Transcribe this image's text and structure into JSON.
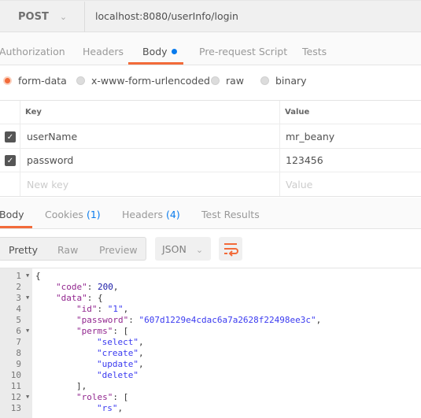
{
  "request": {
    "method": "POST",
    "url": "localhost:8080/userInfo/login"
  },
  "request_tabs": [
    {
      "label": "Authorization"
    },
    {
      "label": "Headers"
    },
    {
      "label": "Body",
      "active": true
    },
    {
      "label": "Pre-request Script"
    },
    {
      "label": "Tests"
    }
  ],
  "body_types": [
    {
      "label": "form-data",
      "selected": true
    },
    {
      "label": "x-www-form-urlencoded"
    },
    {
      "label": "raw"
    },
    {
      "label": "binary"
    }
  ],
  "params": {
    "key_header": "Key",
    "value_header": "Value",
    "rows": [
      {
        "key": "userName",
        "value": "mr_beany",
        "checked": true
      },
      {
        "key": "password",
        "value": "123456",
        "checked": true
      }
    ],
    "new_key_placeholder": "New key",
    "new_value_placeholder": "Value"
  },
  "response_tabs": [
    {
      "label": "Body",
      "active": true
    },
    {
      "label": "Cookies",
      "count": "(1)"
    },
    {
      "label": "Headers",
      "count": "(4)"
    },
    {
      "label": "Test Results"
    }
  ],
  "view_modes": [
    "Pretty",
    "Raw",
    "Preview"
  ],
  "format": "JSON",
  "colors": {
    "accent": "#f26b3a",
    "blue": "#097bed"
  },
  "code_lines": [
    {
      "n": "1",
      "fold": true,
      "indent": 0,
      "parts": [
        [
          "p",
          "{"
        ]
      ]
    },
    {
      "n": "2",
      "indent": 1,
      "parts": [
        [
          "k",
          "\"code\""
        ],
        [
          "p",
          ": "
        ],
        [
          "n",
          "200"
        ],
        [
          "p",
          ","
        ]
      ]
    },
    {
      "n": "3",
      "fold": true,
      "indent": 1,
      "parts": [
        [
          "k",
          "\"data\""
        ],
        [
          "p",
          ": {"
        ]
      ]
    },
    {
      "n": "4",
      "indent": 2,
      "parts": [
        [
          "k",
          "\"id\""
        ],
        [
          "p",
          ": "
        ],
        [
          "s",
          "\"1\""
        ],
        [
          "p",
          ","
        ]
      ]
    },
    {
      "n": "5",
      "indent": 2,
      "parts": [
        [
          "k",
          "\"password\""
        ],
        [
          "p",
          ": "
        ],
        [
          "s",
          "\"607d1229e4cdac6a7a2628f22498ee3c\""
        ],
        [
          "p",
          ","
        ]
      ]
    },
    {
      "n": "6",
      "fold": true,
      "indent": 2,
      "parts": [
        [
          "k",
          "\"perms\""
        ],
        [
          "p",
          ": ["
        ]
      ]
    },
    {
      "n": "7",
      "indent": 3,
      "parts": [
        [
          "s",
          "\"select\""
        ],
        [
          "p",
          ","
        ]
      ]
    },
    {
      "n": "8",
      "indent": 3,
      "parts": [
        [
          "s",
          "\"create\""
        ],
        [
          "p",
          ","
        ]
      ]
    },
    {
      "n": "9",
      "indent": 3,
      "parts": [
        [
          "s",
          "\"update\""
        ],
        [
          "p",
          ","
        ]
      ]
    },
    {
      "n": "10",
      "indent": 3,
      "parts": [
        [
          "s",
          "\"delete\""
        ]
      ]
    },
    {
      "n": "11",
      "indent": 2,
      "parts": [
        [
          "p",
          "],"
        ]
      ]
    },
    {
      "n": "12",
      "fold": true,
      "indent": 2,
      "parts": [
        [
          "k",
          "\"roles\""
        ],
        [
          "p",
          ": ["
        ]
      ]
    },
    {
      "n": "13",
      "indent": 3,
      "parts": [
        [
          "s",
          "\"rs\""
        ],
        [
          "p",
          ","
        ]
      ]
    }
  ]
}
